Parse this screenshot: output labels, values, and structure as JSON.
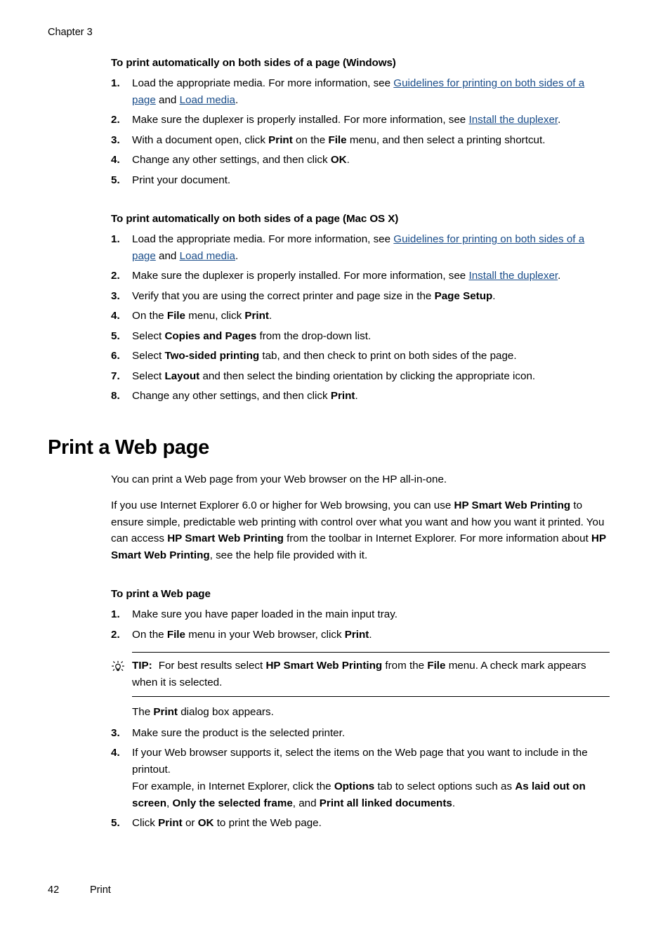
{
  "header": {
    "chapter": "Chapter 3"
  },
  "colors": {
    "link": "#1a4d8a",
    "text": "#000000",
    "background": "#ffffff"
  },
  "section_windows": {
    "heading": "To print automatically on both sides of a page (Windows)",
    "steps": [
      {
        "num": "1.",
        "parts": [
          {
            "t": "Load the appropriate media. For more information, see ",
            "s": "plain"
          },
          {
            "t": "Guidelines for printing on both sides of a page",
            "s": "link"
          },
          {
            "t": " and ",
            "s": "plain"
          },
          {
            "t": "Load media",
            "s": "link"
          },
          {
            "t": ".",
            "s": "plain"
          }
        ]
      },
      {
        "num": "2.",
        "parts": [
          {
            "t": "Make sure the duplexer is properly installed. For more information, see ",
            "s": "plain"
          },
          {
            "t": "Install the duplexer",
            "s": "link"
          },
          {
            "t": ".",
            "s": "plain"
          }
        ]
      },
      {
        "num": "3.",
        "parts": [
          {
            "t": "With a document open, click ",
            "s": "plain"
          },
          {
            "t": "Print",
            "s": "bold"
          },
          {
            "t": " on the ",
            "s": "plain"
          },
          {
            "t": "File",
            "s": "bold"
          },
          {
            "t": " menu, and then select a printing shortcut.",
            "s": "plain"
          }
        ]
      },
      {
        "num": "4.",
        "parts": [
          {
            "t": "Change any other settings, and then click ",
            "s": "plain"
          },
          {
            "t": "OK",
            "s": "bold"
          },
          {
            "t": ".",
            "s": "plain"
          }
        ]
      },
      {
        "num": "5.",
        "parts": [
          {
            "t": "Print your document.",
            "s": "plain"
          }
        ]
      }
    ]
  },
  "section_mac": {
    "heading": "To print automatically on both sides of a page (Mac OS X)",
    "steps": [
      {
        "num": "1.",
        "parts": [
          {
            "t": "Load the appropriate media. For more information, see ",
            "s": "plain"
          },
          {
            "t": "Guidelines for printing on both sides of a page",
            "s": "link"
          },
          {
            "t": " and ",
            "s": "plain"
          },
          {
            "t": "Load media",
            "s": "link"
          },
          {
            "t": ".",
            "s": "plain"
          }
        ]
      },
      {
        "num": "2.",
        "parts": [
          {
            "t": "Make sure the duplexer is properly installed. For more information, see ",
            "s": "plain"
          },
          {
            "t": "Install the duplexer",
            "s": "link"
          },
          {
            "t": ".",
            "s": "plain"
          }
        ]
      },
      {
        "num": "3.",
        "parts": [
          {
            "t": "Verify that you are using the correct printer and page size in the ",
            "s": "plain"
          },
          {
            "t": "Page Setup",
            "s": "bold"
          },
          {
            "t": ".",
            "s": "plain"
          }
        ]
      },
      {
        "num": "4.",
        "parts": [
          {
            "t": "On the ",
            "s": "plain"
          },
          {
            "t": "File",
            "s": "bold"
          },
          {
            "t": " menu, click ",
            "s": "plain"
          },
          {
            "t": "Print",
            "s": "bold"
          },
          {
            "t": ".",
            "s": "plain"
          }
        ]
      },
      {
        "num": "5.",
        "parts": [
          {
            "t": "Select ",
            "s": "plain"
          },
          {
            "t": "Copies and Pages",
            "s": "bold"
          },
          {
            "t": " from the drop-down list.",
            "s": "plain"
          }
        ]
      },
      {
        "num": "6.",
        "parts": [
          {
            "t": "Select ",
            "s": "plain"
          },
          {
            "t": "Two-sided printing",
            "s": "bold"
          },
          {
            "t": " tab, and then check to print on both sides of the page.",
            "s": "plain"
          }
        ]
      },
      {
        "num": "7.",
        "parts": [
          {
            "t": "Select ",
            "s": "plain"
          },
          {
            "t": "Layout",
            "s": "bold"
          },
          {
            "t": " and then select the binding orientation by clicking the appropriate icon.",
            "s": "plain"
          }
        ]
      },
      {
        "num": "8.",
        "parts": [
          {
            "t": "Change any other settings, and then click ",
            "s": "plain"
          },
          {
            "t": "Print",
            "s": "bold"
          },
          {
            "t": ".",
            "s": "plain"
          }
        ]
      }
    ]
  },
  "web_section": {
    "title": "Print a Web page",
    "paragraphs": [
      [
        {
          "t": "You can print a Web page from your Web browser on the HP all-in-one.",
          "s": "plain"
        }
      ],
      [
        {
          "t": "If you use Internet Explorer 6.0 or higher for Web browsing, you can use ",
          "s": "plain"
        },
        {
          "t": "HP Smart Web Printing",
          "s": "bold"
        },
        {
          "t": " to ensure simple, predictable web printing with control over what you want and how you want it printed. You can access ",
          "s": "plain"
        },
        {
          "t": "HP Smart Web Printing",
          "s": "bold"
        },
        {
          "t": " from the toolbar in Internet Explorer. For more information about ",
          "s": "plain"
        },
        {
          "t": "HP Smart Web Printing",
          "s": "bold"
        },
        {
          "t": ", see the help file provided with it.",
          "s": "plain"
        }
      ]
    ],
    "proc_heading": "To print a Web page",
    "steps_before_tip": [
      {
        "num": "1.",
        "parts": [
          {
            "t": "Make sure you have paper loaded in the main input tray.",
            "s": "plain"
          }
        ]
      },
      {
        "num": "2.",
        "parts": [
          {
            "t": "On the ",
            "s": "plain"
          },
          {
            "t": "File",
            "s": "bold"
          },
          {
            "t": " menu in your Web browser, click ",
            "s": "plain"
          },
          {
            "t": "Print",
            "s": "bold"
          },
          {
            "t": ".",
            "s": "plain"
          }
        ]
      }
    ],
    "tip": {
      "icon": "lightbulb-icon",
      "label": "TIP:",
      "parts": [
        {
          "t": "For best results select ",
          "s": "plain"
        },
        {
          "t": "HP Smart Web Printing",
          "s": "bold"
        },
        {
          "t": " from the ",
          "s": "plain"
        },
        {
          "t": "File",
          "s": "bold"
        },
        {
          "t": " menu. A check mark appears when it is selected.",
          "s": "plain"
        }
      ]
    },
    "after_tip": [
      {
        "t": "The ",
        "s": "plain"
      },
      {
        "t": "Print",
        "s": "bold"
      },
      {
        "t": " dialog box appears.",
        "s": "plain"
      }
    ],
    "steps_after_tip": [
      {
        "num": "3.",
        "parts": [
          {
            "t": "Make sure the product is the selected printer.",
            "s": "plain"
          }
        ]
      },
      {
        "num": "4.",
        "parts": [
          {
            "t": "If your Web browser supports it, select the items on the Web page that you want to include in the printout.",
            "s": "plain"
          }
        ],
        "sub_parts": [
          {
            "t": "For example, in Internet Explorer, click the ",
            "s": "plain"
          },
          {
            "t": "Options",
            "s": "bold"
          },
          {
            "t": " tab to select options such as ",
            "s": "plain"
          },
          {
            "t": "As laid out on screen",
            "s": "bold"
          },
          {
            "t": ", ",
            "s": "plain"
          },
          {
            "t": "Only the selected frame",
            "s": "bold"
          },
          {
            "t": ", and ",
            "s": "plain"
          },
          {
            "t": "Print all linked documents",
            "s": "bold"
          },
          {
            "t": ".",
            "s": "plain"
          }
        ]
      },
      {
        "num": "5.",
        "parts": [
          {
            "t": "Click ",
            "s": "plain"
          },
          {
            "t": "Print",
            "s": "bold"
          },
          {
            "t": " or ",
            "s": "plain"
          },
          {
            "t": "OK",
            "s": "bold"
          },
          {
            "t": " to print the Web page.",
            "s": "plain"
          }
        ]
      }
    ]
  },
  "footer": {
    "page_number": "42",
    "section_label": "Print"
  }
}
